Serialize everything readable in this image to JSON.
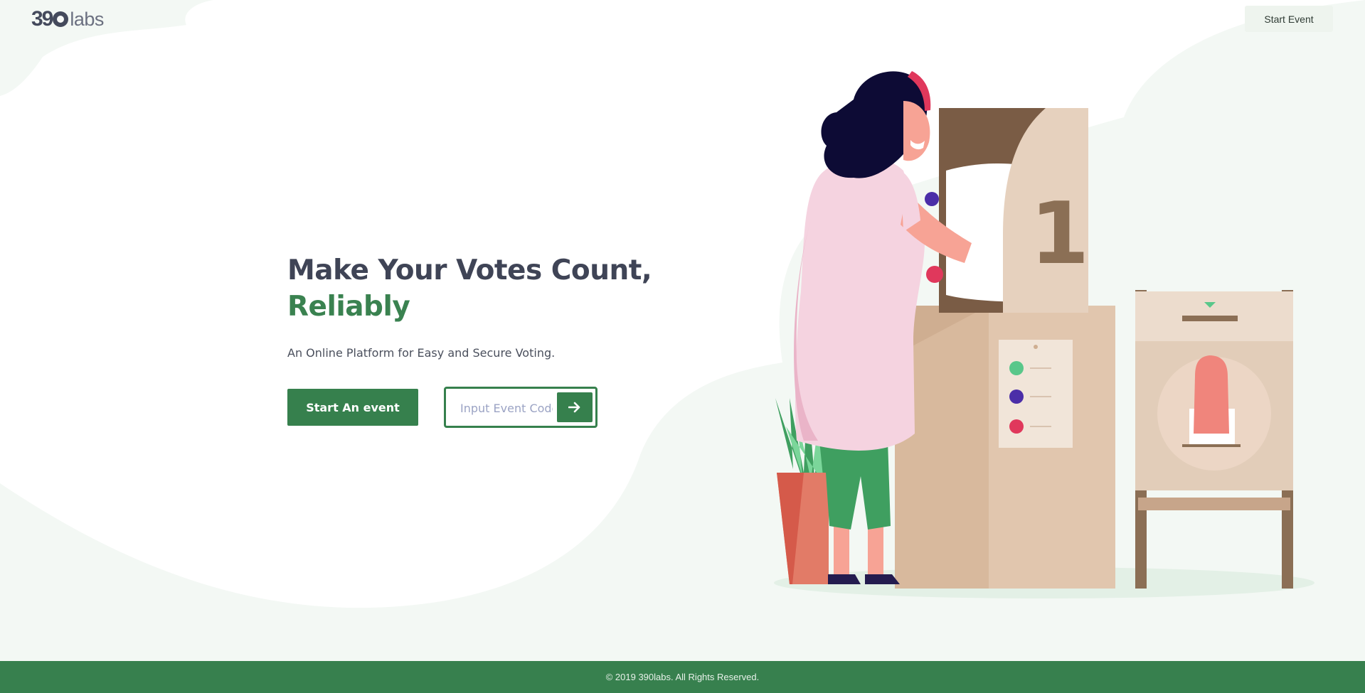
{
  "header": {
    "logo_number": "39",
    "logo_text": "labs",
    "start_event_label": "Start Event"
  },
  "hero": {
    "title_line1": "Make Your Votes Count,",
    "title_line2": "Reliably",
    "subtitle": "An Online Platform for Easy and Secure Voting.",
    "start_button_label": "Start An event",
    "event_code_placeholder": "Input Event Code",
    "go_icon": "arrow-right-icon"
  },
  "illustration": {
    "booth_number": "1"
  },
  "footer": {
    "copyright": "© 2019 390labs. All Rights Reserved."
  },
  "colors": {
    "brand_green": "#36804d",
    "heading": "#3f4456",
    "background_tint": "#f3f8f4"
  }
}
